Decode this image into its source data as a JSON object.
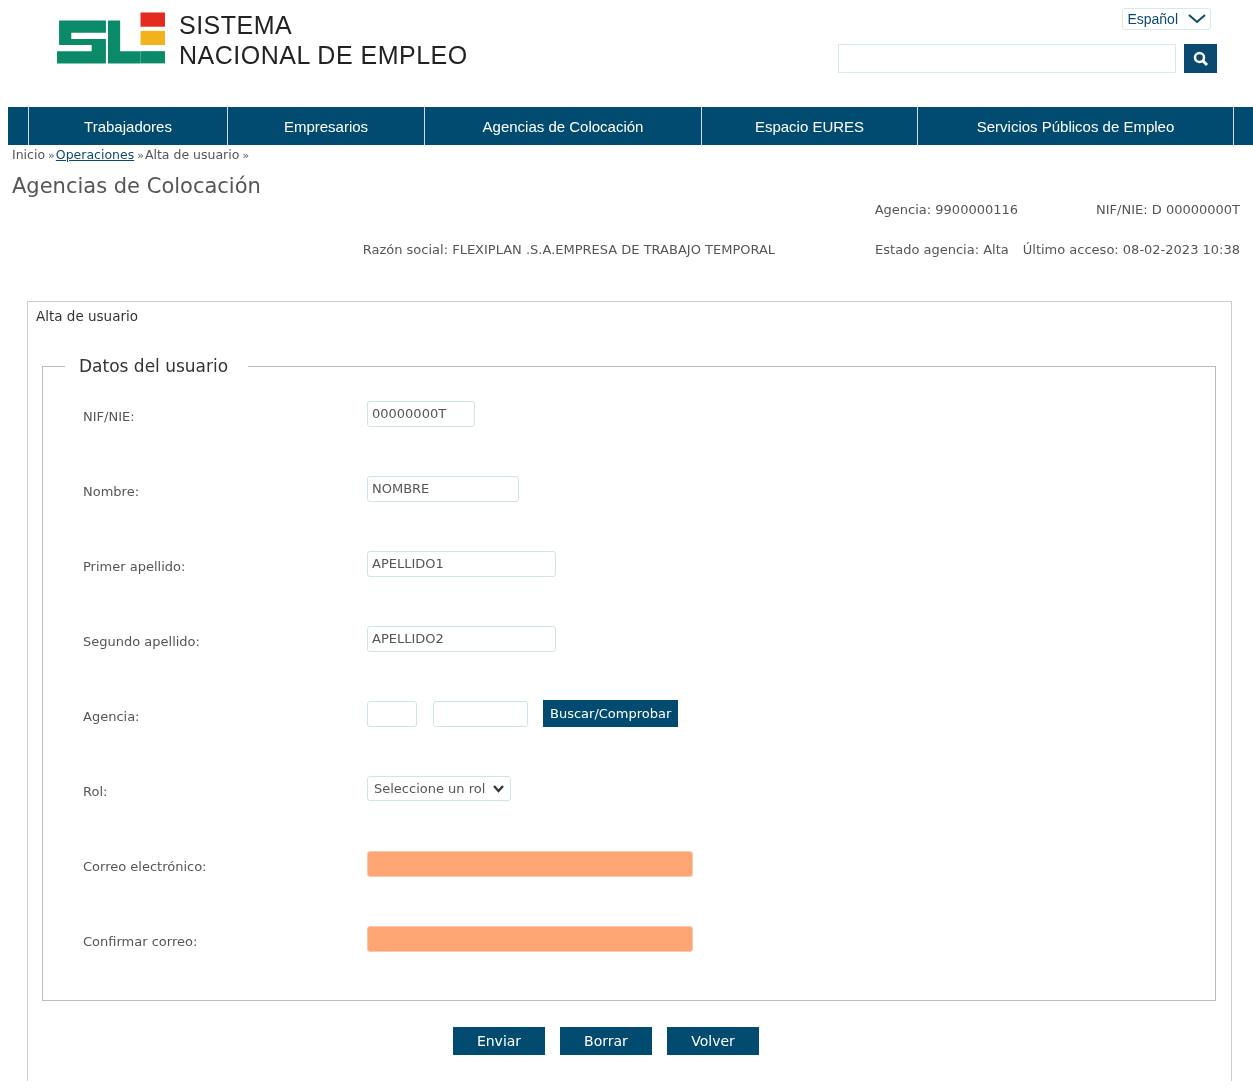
{
  "logo": {
    "line_1": "SISTEMA",
    "line_2": "NACIONAL DE EMPLEO"
  },
  "language": "Español",
  "nav": [
    {
      "label": "Trabajadores"
    },
    {
      "label": "Empresarios"
    },
    {
      "label": "Agencias de Colocación"
    },
    {
      "label": "Espacio EURES"
    },
    {
      "label": "Servicios Públicos de Empleo"
    }
  ],
  "breadcrumb": [
    {
      "label": "Inicio",
      "link": false
    },
    {
      "label": "Operaciones",
      "link": true
    },
    {
      "label": "Alta de usuario",
      "link": false
    }
  ],
  "breadcrumb_separator": "»",
  "page_title": "Agencias de Colocación",
  "agency_info": {
    "agencia": "Agencia: 9900000116",
    "nif": "NIF/NIE: D 00000000T",
    "razon_social": "Razón social: FLEXIPLAN .S.A.EMPRESA DE TRABAJO TEMPORAL",
    "estado": "Estado agencia: Alta",
    "ultimo_acceso": "Último acceso: 08-02-2023 10:38"
  },
  "panel_title": "Alta de usuario",
  "fieldset_title": "Datos del usuario",
  "fields": [
    {
      "kind": "text",
      "label": "NIF/NIE:",
      "value": "00000000T",
      "highlighted": false
    },
    {
      "kind": "text",
      "label": "Nombre:",
      "value": "NOMBRE",
      "highlighted": false
    },
    {
      "kind": "text",
      "label": "Primer apellido:",
      "value": "APELLIDO1",
      "highlighted": false
    },
    {
      "kind": "text",
      "label": "Segundo apellido:",
      "value": "APELLIDO2",
      "highlighted": false
    },
    {
      "kind": "agency",
      "label": "Agencia:",
      "button": "Buscar/Comprobar"
    },
    {
      "kind": "select",
      "label": "Rol:",
      "value": "Seleccione un rol"
    },
    {
      "kind": "text",
      "label": "Correo electrónico:",
      "highlighted": true
    },
    {
      "kind": "text",
      "label": "Confirmar correo:",
      "highlighted": true
    }
  ],
  "buttons": [
    "Enviar",
    "Borrar",
    "Volver"
  ]
}
